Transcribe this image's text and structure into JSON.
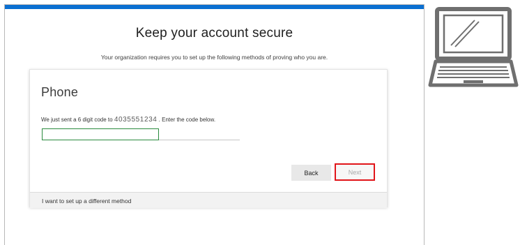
{
  "header": {
    "title": "Keep your account secure",
    "subtitle": "Your organization requires you to set up the following methods of proving who you are."
  },
  "card": {
    "heading": "Phone",
    "instruction_before": "We just sent a 6 digit code to",
    "phone_number": "4035551234",
    "instruction_after": ". Enter the code below.",
    "code_input": {
      "value": "",
      "placeholder": ""
    },
    "back_label": "Back",
    "next_label": "Next",
    "footer_link": "I want to set up a different method"
  },
  "colors": {
    "accent_bar": "#0a6fd1",
    "input_border": "#2a8a3e",
    "highlight_outline": "#e1151a"
  },
  "icons": [
    "laptop-icon"
  ]
}
